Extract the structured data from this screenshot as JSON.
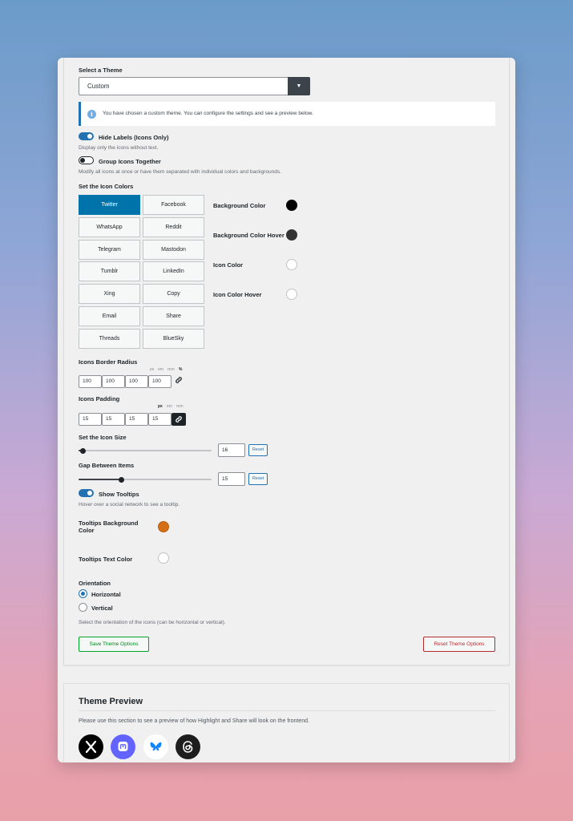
{
  "theme": {
    "label": "Select a Theme",
    "selected": "Custom",
    "notice": "You have chosen a custom theme. You can configure the settings and see a preview below."
  },
  "hide_labels": {
    "label": "Hide Labels (Icons Only)",
    "desc": "Display only the icons without text.",
    "on": true
  },
  "group_icons": {
    "label": "Group Icons Together",
    "desc": "Modify all icons at once or have them separated with individual colors and backgrounds.",
    "on": false
  },
  "icon_colors": {
    "label": "Set the Icon Colors",
    "networks": [
      "Twitter",
      "Facebook",
      "WhatsApp",
      "Reddit",
      "Telegram",
      "Mastodon",
      "Tumblr",
      "LinkedIn",
      "Xing",
      "Copy",
      "Email",
      "Share",
      "Threads",
      "BlueSky"
    ],
    "active": "Twitter",
    "color_settings": [
      {
        "label": "Background Color",
        "color": "#000000"
      },
      {
        "label": "Background Color Hover",
        "color": "#333333"
      },
      {
        "label": "Icon Color",
        "color": "#ffffff"
      },
      {
        "label": "Icon Color Hover",
        "color": "#ffffff"
      }
    ]
  },
  "border_radius": {
    "label": "Icons Border Radius",
    "units": [
      "px",
      "em",
      "rem",
      "%"
    ],
    "selected_unit": "%",
    "values": [
      "100",
      "100",
      "100",
      "100"
    ]
  },
  "padding": {
    "label": "Icons Padding",
    "units": [
      "px",
      "em",
      "rem"
    ],
    "selected_unit": "px",
    "values": [
      "15",
      "15",
      "15",
      "15"
    ]
  },
  "icon_size": {
    "label": "Set the Icon Size",
    "value": "16",
    "fraction": 0.03,
    "reset": "Reset"
  },
  "gap": {
    "label": "Gap Between Items",
    "value": "15",
    "fraction": 0.32,
    "reset": "Reset"
  },
  "tooltips": {
    "label": "Show Tooltips",
    "desc": "Hover over a social network to see a tooltip.",
    "on": true,
    "bg_label": "Tooltips Background Color",
    "bg_color": "#d46f15",
    "text_label": "Tooltips Text Color",
    "text_color": "#ffffff"
  },
  "orientation": {
    "label": "Orientation",
    "options": [
      "Horizontal",
      "Vertical"
    ],
    "selected": "Horizontal",
    "desc": "Select the orientation of the icons (can be horizontal or vertical)."
  },
  "actions": {
    "save": "Save Theme Options",
    "reset": "Reset Theme Options"
  },
  "preview": {
    "title": "Theme Preview",
    "desc": "Please use this section to see a preview of how Highlight and Share will look on the frontend.",
    "icons": [
      {
        "name": "x-icon",
        "bg": "#000000"
      },
      {
        "name": "mastodon-icon",
        "bg": "#6364ff"
      },
      {
        "name": "bluesky-icon",
        "bg": "#ffffff"
      },
      {
        "name": "threads-icon",
        "bg": "#1d1d1d"
      }
    ]
  },
  "icons": {
    "info": "info-icon",
    "dropdown": "caret-down-icon",
    "link": "link-icon"
  }
}
